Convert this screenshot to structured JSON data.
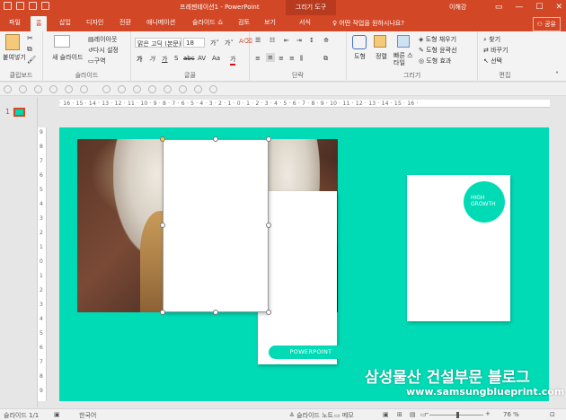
{
  "titlebar": {
    "title": "프레젠테이션1 - PowerPoint",
    "context_tab_group": "그리기 도구",
    "user": "이해강"
  },
  "tabs": [
    {
      "label": "파일"
    },
    {
      "label": "홈"
    },
    {
      "label": "삽입"
    },
    {
      "label": "디자인"
    },
    {
      "label": "전환"
    },
    {
      "label": "애니메이션"
    },
    {
      "label": "슬라이드 쇼"
    },
    {
      "label": "검토"
    },
    {
      "label": "보기"
    },
    {
      "label": "서식"
    }
  ],
  "tellme": "어떤 작업을 원하시나요?",
  "share": "공유",
  "ribbon": {
    "clipboard": {
      "paste": "붙여넣기",
      "label": "클립보드"
    },
    "slides": {
      "new_slide": "새 슬라이드",
      "layout": "레이아웃",
      "reset": "다시 설정",
      "section": "구역",
      "label": "슬라이드"
    },
    "font": {
      "family": "맑은 고딕 (본문)",
      "size": "18",
      "label": "글꼴"
    },
    "paragraph": {
      "label": "단락"
    },
    "drawing": {
      "shapes": "도형",
      "arrange": "정렬",
      "quick_styles": "빠른 스타일",
      "fill": "도형 채우기",
      "outline": "도형 윤곽선",
      "effects": "도형 효과",
      "label": "그리기"
    },
    "editing": {
      "find": "찾기",
      "replace": "바꾸기",
      "select": "선택",
      "label": "편집"
    }
  },
  "left_pane": {
    "slide_number": "1"
  },
  "ruler": {
    "horizontal": "· 16 · 15 · 14 · 13 · 12 · 11 · 10 · 9 · 8 · 7 · 6 · 5 · 4 · 3 · 2 · 1 · 0 · 1 · 2 · 3 · 4 · 5 · 6 · 7 · 8 · 9 · 10 · 11 · 12 · 13 · 14 · 15 · 16 ·",
    "vertical": [
      "9",
      "8",
      "7",
      "6",
      "5",
      "4",
      "3",
      "2",
      "1",
      "0",
      "1",
      "2",
      "3",
      "4",
      "5",
      "6",
      "7",
      "8",
      "9"
    ]
  },
  "slide": {
    "background": "#00DBB6",
    "button_text": "POWERPOINT",
    "circle_line1": "HIGH",
    "circle_line2": "GROWTH"
  },
  "watermark": {
    "title": "삼성물산 건설부문 블로그",
    "url": "www.samsungblueprint.com"
  },
  "statusbar": {
    "slide_info": "슬라이드 1/1",
    "language": "한국어",
    "notes": "슬라이드 노트",
    "comments": "메모",
    "zoom": "76 %"
  },
  "colors": {
    "accent": "#D24726",
    "slide_teal": "#00DBB6"
  }
}
